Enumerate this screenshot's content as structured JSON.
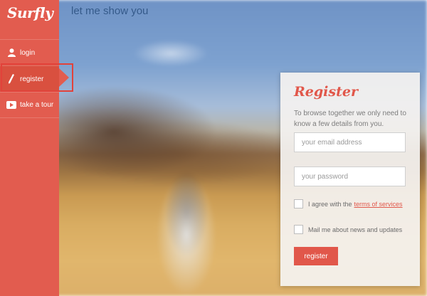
{
  "app": {
    "logo_text": "Surfly",
    "page_title": "let me show you"
  },
  "sidebar": {
    "items": [
      {
        "label": "login",
        "icon": "user-icon"
      },
      {
        "label": "register",
        "icon": "pencil-icon"
      },
      {
        "label": "take a tour",
        "icon": "play-icon"
      }
    ]
  },
  "register": {
    "title": "Register",
    "description": "To browse together we only need to know a few details from you.",
    "email_placeholder": "your email address",
    "password_placeholder": "your password",
    "agree_text": "I agree with the",
    "terms_link": "terms of services",
    "mail_text": "Mail me about news and updates",
    "button_label": "register"
  },
  "colors": {
    "accent": "#e25c4f",
    "title_blue": "#355a8a",
    "highlight": "#e2423a"
  }
}
